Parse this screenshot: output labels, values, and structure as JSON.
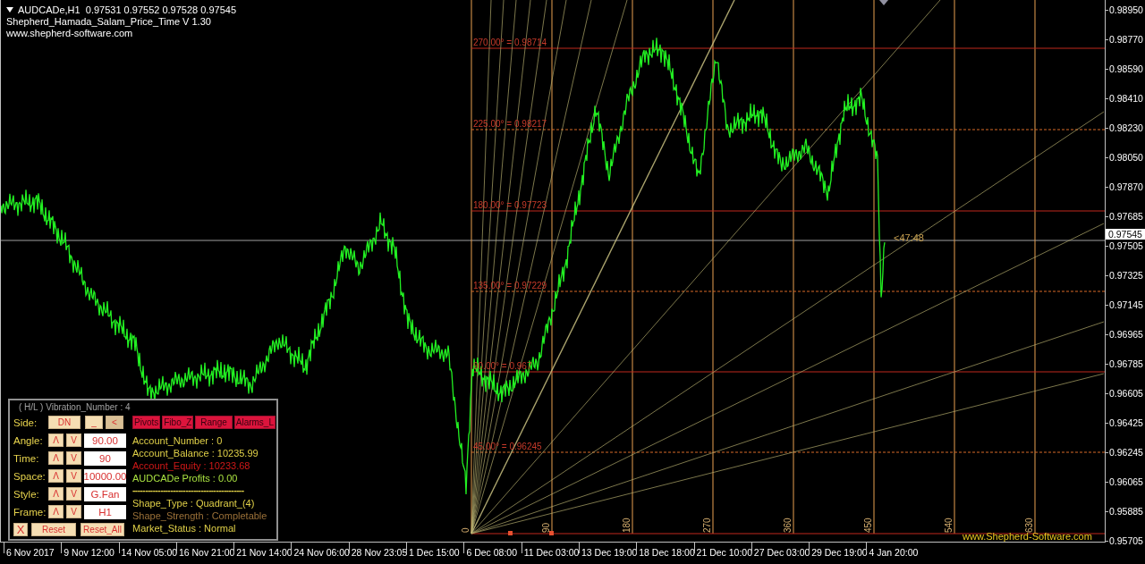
{
  "header": {
    "symbol_line": "AUDCADe,H1  0.97531 0.97552 0.97528 0.97545",
    "indicator": "Shepherd_Hamada_Salam_Price_Time V 1.30",
    "website": "www.shepherd-software.com"
  },
  "chart": {
    "levels": [
      {
        "label": "270.00° = 0.98714",
        "kind": "solid"
      },
      {
        "label": "225.00° = 0.98217",
        "kind": "dashed"
      },
      {
        "label": "180.00° = 0.97723",
        "kind": "solid"
      },
      {
        "label": "135.00° = 0.97229",
        "kind": "dashed"
      },
      {
        "label": "90.00° = 0.967",
        "kind": "solid"
      },
      {
        "label": "45.00° = 0.96245",
        "kind": "dashed"
      }
    ],
    "cycle_labels": [
      "0",
      "90",
      "180",
      "270",
      "360",
      "450",
      "540",
      "630"
    ],
    "timer": "<47:48",
    "brand_link": "www.Shepherd-Software.com"
  },
  "price_axis": {
    "labels": [
      "0.98950",
      "0.98770",
      "0.98590",
      "0.98410",
      "0.98230",
      "0.98050",
      "0.97870",
      "0.97685",
      "0.97505",
      "0.97325",
      "0.97145",
      "0.96965",
      "0.96785",
      "0.96605",
      "0.96425",
      "0.96245",
      "0.96065",
      "0.95885",
      "0.95705"
    ],
    "current": "0.97545"
  },
  "time_axis": {
    "labels": [
      "6 Nov 2017",
      "9 Nov 12:00",
      "14 Nov 05:00",
      "16 Nov 21:00",
      "21 Nov 14:00",
      "24 Nov 06:00",
      "28 Nov 23:05",
      "1 Dec 15:00",
      "6 Dec 08:00",
      "11 Dec 03:00",
      "13 Dec 19:00",
      "18 Dec 18:00",
      "21 Dec 10:00",
      "27 Dec 03:00",
      "29 Dec 19:00",
      "4 Jan 20:00"
    ]
  },
  "panel": {
    "title": "( H/L ) Vibration_Number : 4",
    "side": {
      "label": "Side:",
      "buttons": [
        {
          "text": "DN",
          "selected": false
        },
        {
          "text": "_",
          "selected": false
        },
        {
          "text": "<",
          "selected": true
        }
      ]
    },
    "spinners": [
      {
        "label": "Angle:",
        "up": "Λ",
        "down": "V",
        "value": "90.00"
      },
      {
        "label": "Time:",
        "up": "Λ",
        "down": "V",
        "value": "90"
      },
      {
        "label": "Space:",
        "up": "Λ",
        "down": "V",
        "value": "10000.00"
      },
      {
        "label": "Style:",
        "up": "Λ",
        "down": "V",
        "value": "G.Fan"
      },
      {
        "label": "Frame:",
        "up": "Λ",
        "down": "V",
        "value": "H1"
      }
    ],
    "actions": [
      "X",
      "Reset",
      "Reset_All"
    ],
    "tabs": [
      "Pivots",
      "Fibo_Z",
      "Range",
      "Alarms_L"
    ],
    "info": [
      {
        "kind": "text",
        "text": "Account_Number : 0",
        "color": "#e0d048"
      },
      {
        "kind": "text",
        "text": "Account_Balance : 10235.99",
        "color": "#e0d048"
      },
      {
        "kind": "text",
        "text": "Account_Equity : 10233.68",
        "color": "#d01818"
      },
      {
        "kind": "text",
        "text": "AUDCADe Profits : 0.00",
        "color": "#a8e040"
      },
      {
        "kind": "separator",
        "text": "--------------------------------------------",
        "color": "#e0d048"
      },
      {
        "kind": "text",
        "text": "Shape_Type : Quadrant_(4)",
        "color": "#e0d048"
      },
      {
        "kind": "text",
        "text": "Shape_Strength : Completable",
        "color": "#9a7038"
      },
      {
        "kind": "text",
        "text": "Market_Status : Normal",
        "color": "#e0d048"
      }
    ]
  }
}
